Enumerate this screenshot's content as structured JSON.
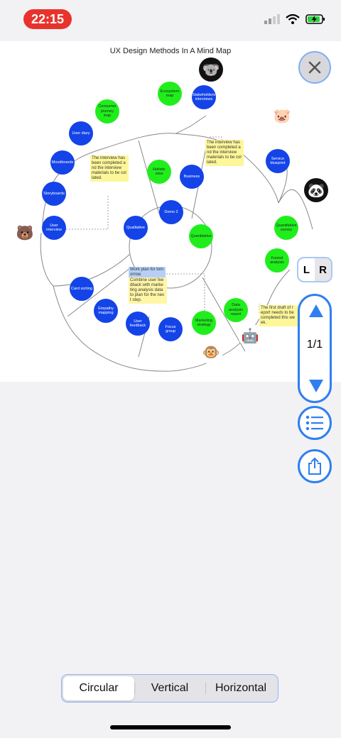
{
  "status": {
    "time": "22:15"
  },
  "map": {
    "title": "UX Design Methods In A Mind Map",
    "center": "Demo 2",
    "nodes": {
      "holistic_view": "Holistic view",
      "business": "Business",
      "qualitative": "Qualitative",
      "quantitative": "Quantitative",
      "user_interview": "User interview",
      "storyboards": "Storyboards",
      "moodboards": "Moodboards",
      "user_diary": "User diary",
      "consumer_journey_map": "Consumer journey map",
      "ecosystem_map": "Ecosystem map",
      "stakeholders_interviews": "Stakeholders interviews",
      "service_blueprint": "Service blueprint",
      "quantitative_survey": "Quantitative survey",
      "funnel_analysis": "Funnel analysis",
      "data_analysis_report": "Data analysis report",
      "marketing_strategy": "Marketing strategy",
      "focus_group": "Focus group",
      "user_feedback": "User feedback",
      "empathy_mapping": "Empathy mapping",
      "card_sorting": "Card sorting"
    },
    "notes": {
      "note_left": "The interview has been completed a nd the interview materials to be col lated.",
      "note_top": "The interview has been completed a nd the interview materials to be col lated.",
      "note_work_plan": "Work plan for tom orrow.",
      "note_combine": "Combine user fee dback with marke ting analysis data to plan for the nex t step.",
      "note_draft": "The first draft of r eport needs to be completed this we ek."
    }
  },
  "controls": {
    "lr_left": "L",
    "lr_right": "R",
    "page_indicator": "1/1",
    "layout_tabs": [
      "Circular",
      "Vertical",
      "Horizontal"
    ],
    "active_layout": "Circular"
  },
  "icons": {
    "close": "close-icon",
    "up": "arrow-up-icon",
    "down": "arrow-down-icon",
    "list": "list-icon",
    "share": "share-icon"
  },
  "colors": {
    "blue_node": "#1443e8",
    "green_node": "#20ee1c",
    "accent": "#2f7ff0",
    "time_pill": "#e8332c"
  }
}
